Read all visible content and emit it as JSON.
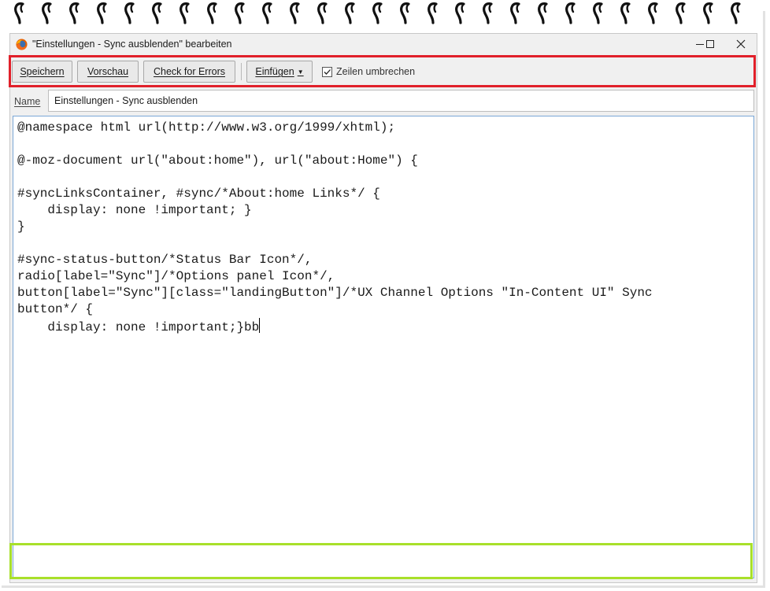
{
  "window": {
    "title": "\"Einstellungen - Sync ausblenden\" bearbeiten"
  },
  "toolbar": {
    "save_label": "Speichern",
    "preview_label": "Vorschau",
    "check_label": "Check for Errors",
    "insert_label": "Einfügen",
    "wrap_label": "Zeilen umbrechen",
    "wrap_checked": true
  },
  "name_field": {
    "label": "Name",
    "value": "Einstellungen - Sync ausblenden"
  },
  "editor": {
    "code": "@namespace html url(http://www.w3.org/1999/xhtml);\n\n@-moz-document url(\"about:home\"), url(\"about:Home\") {\n\n#syncLinksContainer, #sync/*About:home Links*/ {\n    display: none !important; }\n}\n\n#sync-status-button/*Status Bar Icon*/,\nradio[label=\"Sync\"]/*Options panel Icon*/,\nbutton[label=\"Sync\"][class=\"landingButton\"]/*UX Channel Options \"In-Content UI\" Sync\nbutton*/ {\n    display: none !important;}bb"
  },
  "icons": {
    "app": "firefox-icon",
    "minimize": "minimize-icon",
    "maximize": "maximize-icon",
    "close": "close-icon",
    "checkbox": "checkmark-icon",
    "dropdown": "caret-down-icon"
  },
  "colors": {
    "highlight_red": "#e1202a",
    "highlight_green": "#a8e02a",
    "editor_border": "#7aa7d6"
  }
}
